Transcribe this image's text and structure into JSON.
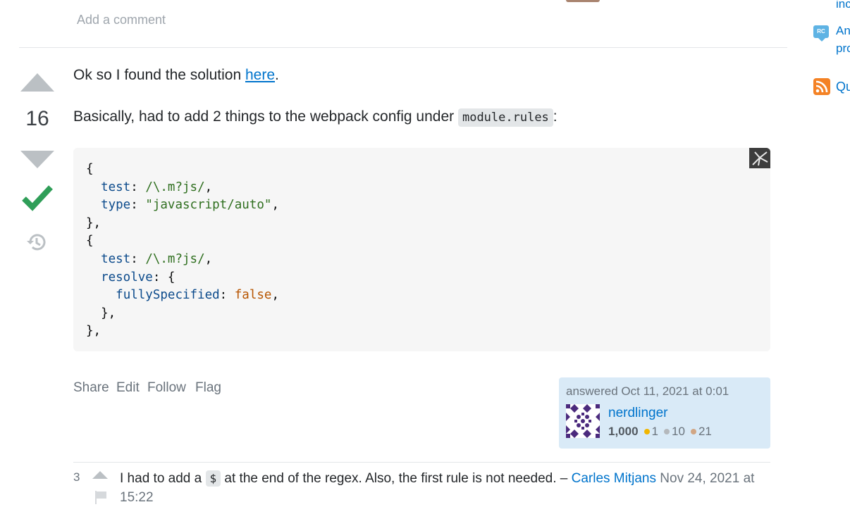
{
  "top": {
    "add_comment": "Add a comment"
  },
  "sidebar": {
    "items": [
      {
        "text": "inc"
      },
      {
        "badge": "RC",
        "line1": "An",
        "line2": "pro"
      },
      {
        "icon": "rss-icon",
        "text": "Qu"
      }
    ]
  },
  "answer": {
    "score": "16",
    "accepted": true,
    "para1_before": "Ok so I found the solution ",
    "para1_link": "here",
    "para1_after": ".",
    "para2_before": "Basically, had to add 2 things to the webpack config under ",
    "para2_code": "module.rules",
    "para2_after": ":",
    "code": {
      "l1": "{",
      "l2_key": "test",
      "l2_val": "/\\.m?js/",
      "l3_key": "type",
      "l3_val": "\"javascript/auto\"",
      "l4": "},",
      "l5": "{",
      "l6_key": "test",
      "l6_val": "/\\.m?js/",
      "l7_key": "resolve",
      "l8_key": "fullySpecified",
      "l8_val": "false",
      "l9": "},",
      "l10": "},"
    },
    "actions": {
      "share": "Share",
      "edit": "Edit",
      "follow": "Follow",
      "flag": "Flag"
    },
    "signature": {
      "answered": "answered Oct 11, 2021 at 0:01",
      "user": "nerdlinger",
      "reputation": "1,000",
      "gold": "1",
      "silver": "10",
      "bronze": "21"
    }
  },
  "comment": {
    "score": "3",
    "text_before": "I had to add a ",
    "text_code": "$",
    "text_after": " at the end of the regex. Also, the first rule is not needed. – ",
    "author": "Carles Mitjans",
    "date": "Nov 24, 2021 at 15:22"
  },
  "colors": {
    "link": "#0074cc",
    "accepted": "#2f9e58",
    "signature_bg": "#d9eaf7",
    "code_bg": "#f6f6f6",
    "gold": "#f1b600",
    "silver": "#b4b8bc",
    "bronze": "#d1a684"
  }
}
